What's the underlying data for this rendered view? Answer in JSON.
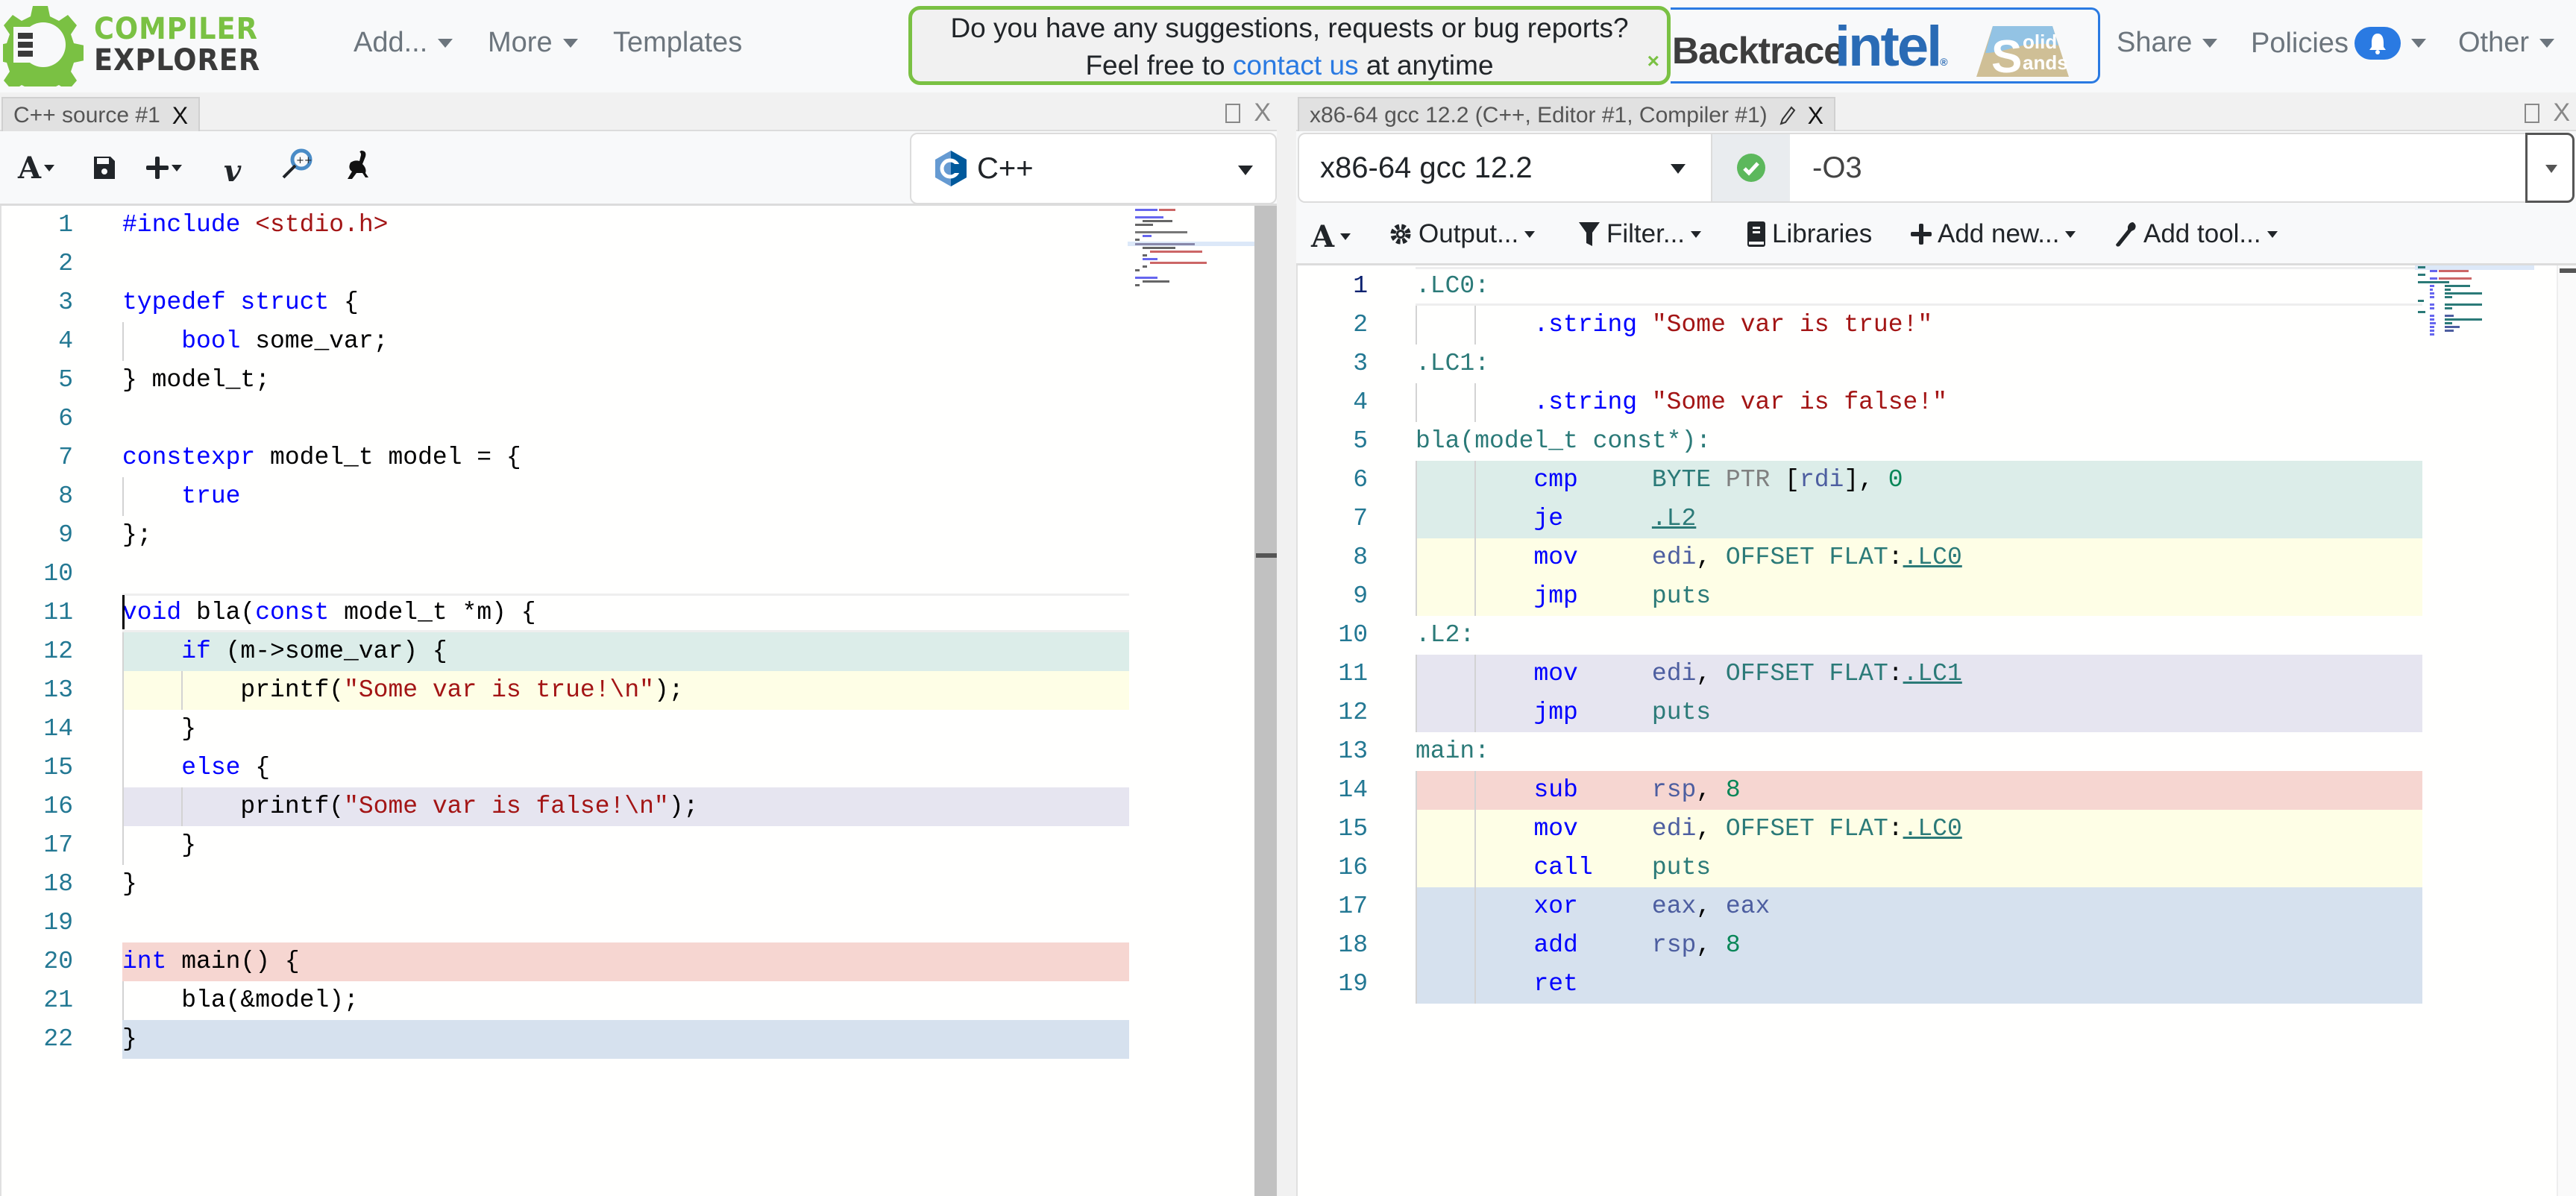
{
  "navbar": {
    "logo_line1": "COMPILER",
    "logo_line2": "EXPLORER",
    "menu": [
      {
        "label": "Add...",
        "has_caret": true
      },
      {
        "label": "More",
        "has_caret": true
      },
      {
        "label": "Templates",
        "has_caret": false
      }
    ],
    "motd": {
      "line1": "Do you have any suggestions, requests or bug reports?",
      "line2_prefix": "Feel free to ",
      "link": "contact us",
      "line2_suffix": " at anytime",
      "close": "×"
    },
    "sponsors": {
      "backtrace": "Backtrace",
      "intel": "intel",
      "intel_mark": "®",
      "solid_s": "S",
      "solid_top": "olid",
      "solid_bottom": "ands"
    },
    "right_menu": [
      {
        "label": "Share"
      },
      {
        "label": "Policies"
      },
      {
        "label": "Other"
      }
    ]
  },
  "source_pane": {
    "tab_title": "C++ source #1",
    "tab_close": "X",
    "pane_close": "X",
    "language": "C++",
    "toolbar_icons": [
      "font-size-icon",
      "save-icon",
      "add-icon",
      "vim-icon",
      "cppinsights-icon",
      "quick-bench-icon"
    ],
    "lines": [
      {
        "n": "1",
        "tokens": [
          [
            "kw",
            "#include "
          ],
          [
            "str",
            "<stdio.h>"
          ]
        ]
      },
      {
        "n": "2",
        "tokens": []
      },
      {
        "n": "3",
        "tokens": [
          [
            "kw",
            "typedef struct"
          ],
          [
            "p",
            " {"
          ]
        ]
      },
      {
        "n": "4",
        "tokens": [
          [
            "p",
            "    "
          ],
          [
            "kw",
            "bool"
          ],
          [
            "p",
            " some_var;"
          ]
        ]
      },
      {
        "n": "5",
        "tokens": [
          [
            "p",
            "} model_t;"
          ]
        ]
      },
      {
        "n": "6",
        "tokens": []
      },
      {
        "n": "7",
        "tokens": [
          [
            "kw",
            "constexpr"
          ],
          [
            "p",
            " model_t model = {"
          ]
        ]
      },
      {
        "n": "8",
        "tokens": [
          [
            "p",
            "    "
          ],
          [
            "kw",
            "true"
          ]
        ]
      },
      {
        "n": "9",
        "tokens": [
          [
            "p",
            "};"
          ]
        ]
      },
      {
        "n": "10",
        "tokens": []
      },
      {
        "n": "11",
        "tokens": [
          [
            "kw",
            "void"
          ],
          [
            "p",
            " bla("
          ],
          [
            "kw",
            "const"
          ],
          [
            "p",
            " model_t *m) {"
          ]
        ]
      },
      {
        "n": "12",
        "tokens": [
          [
            "p",
            "    "
          ],
          [
            "kw",
            "if"
          ],
          [
            "p",
            " (m->some_var) {"
          ]
        ]
      },
      {
        "n": "13",
        "tokens": [
          [
            "p",
            "        printf("
          ],
          [
            "str",
            "\"Some var is true!\\n\""
          ],
          [
            "p",
            ");"
          ]
        ]
      },
      {
        "n": "14",
        "tokens": [
          [
            "p",
            "    }"
          ]
        ]
      },
      {
        "n": "15",
        "tokens": [
          [
            "p",
            "    "
          ],
          [
            "kw",
            "else"
          ],
          [
            "p",
            " {"
          ]
        ]
      },
      {
        "n": "16",
        "tokens": [
          [
            "p",
            "        printf("
          ],
          [
            "str",
            "\"Some var is false!\\n\""
          ],
          [
            "p",
            ");"
          ]
        ]
      },
      {
        "n": "17",
        "tokens": [
          [
            "p",
            "    }"
          ]
        ]
      },
      {
        "n": "18",
        "tokens": [
          [
            "p",
            "}"
          ]
        ]
      },
      {
        "n": "19",
        "tokens": []
      },
      {
        "n": "20",
        "tokens": [
          [
            "kw",
            "int"
          ],
          [
            "p",
            " main() {"
          ]
        ]
      },
      {
        "n": "21",
        "tokens": [
          [
            "p",
            "    bla(&model);"
          ]
        ]
      },
      {
        "n": "22",
        "tokens": [
          [
            "p",
            "}"
          ]
        ]
      }
    ],
    "highlights": {
      "11": "current",
      "12": "#dcede9",
      "13": "#fefee6",
      "16": "#e6e5f0",
      "20": "#f6d6d1",
      "22": "#d6e1ee"
    }
  },
  "compiler_pane": {
    "tab_title": "x86-64 gcc 12.2 (C++, Editor #1, Compiler #1)",
    "tab_close": "X",
    "pane_close": "X",
    "compiler": "x86-64 gcc 12.2",
    "status": "success",
    "options": "-O3",
    "output_toolbar": {
      "output": "Output...",
      "filter": "Filter...",
      "libraries": "Libraries",
      "add_new": "Add new...",
      "add_tool": "Add tool..."
    },
    "lines": [
      {
        "n": "1",
        "tokens": [
          [
            "lbl",
            ".LC0:"
          ]
        ]
      },
      {
        "n": "2",
        "tokens": [
          [
            "p",
            "        "
          ],
          [
            "dir",
            ".string"
          ],
          [
            "p",
            " "
          ],
          [
            "str",
            "\"Some var is true!\""
          ]
        ]
      },
      {
        "n": "3",
        "tokens": [
          [
            "lbl",
            ".LC1:"
          ]
        ]
      },
      {
        "n": "4",
        "tokens": [
          [
            "p",
            "        "
          ],
          [
            "dir",
            ".string"
          ],
          [
            "p",
            " "
          ],
          [
            "str",
            "\"Some var is false!\""
          ]
        ]
      },
      {
        "n": "5",
        "tokens": [
          [
            "lbl",
            "bla(model_t const*):"
          ]
        ]
      },
      {
        "n": "6",
        "tokens": [
          [
            "p",
            "        "
          ],
          [
            "opc",
            "cmp"
          ],
          [
            "p",
            "     "
          ],
          [
            "lbl",
            "BYTE"
          ],
          [
            "p",
            " "
          ],
          [
            "ptr",
            "PTR"
          ],
          [
            "p",
            " ["
          ],
          [
            "reg",
            "rdi"
          ],
          [
            "p",
            "], "
          ],
          [
            "num",
            "0"
          ]
        ]
      },
      {
        "n": "7",
        "tokens": [
          [
            "p",
            "        "
          ],
          [
            "opc",
            "je"
          ],
          [
            "p",
            "      "
          ],
          [
            "link",
            ".L2"
          ]
        ]
      },
      {
        "n": "8",
        "tokens": [
          [
            "p",
            "        "
          ],
          [
            "opc",
            "mov"
          ],
          [
            "p",
            "     "
          ],
          [
            "reg",
            "edi"
          ],
          [
            "p",
            ", "
          ],
          [
            "lbl",
            "OFFSET FLAT"
          ],
          [
            "p",
            ":"
          ],
          [
            "link",
            ".LC0"
          ]
        ]
      },
      {
        "n": "9",
        "tokens": [
          [
            "p",
            "        "
          ],
          [
            "opc",
            "jmp"
          ],
          [
            "p",
            "     "
          ],
          [
            "lbl",
            "puts"
          ]
        ]
      },
      {
        "n": "10",
        "tokens": [
          [
            "lbl",
            ".L2:"
          ]
        ]
      },
      {
        "n": "11",
        "tokens": [
          [
            "p",
            "        "
          ],
          [
            "opc",
            "mov"
          ],
          [
            "p",
            "     "
          ],
          [
            "reg",
            "edi"
          ],
          [
            "p",
            ", "
          ],
          [
            "lbl",
            "OFFSET FLAT"
          ],
          [
            "p",
            ":"
          ],
          [
            "link",
            ".LC1"
          ]
        ]
      },
      {
        "n": "12",
        "tokens": [
          [
            "p",
            "        "
          ],
          [
            "opc",
            "jmp"
          ],
          [
            "p",
            "     "
          ],
          [
            "lbl",
            "puts"
          ]
        ]
      },
      {
        "n": "13",
        "tokens": [
          [
            "lbl",
            "main:"
          ]
        ]
      },
      {
        "n": "14",
        "tokens": [
          [
            "p",
            "        "
          ],
          [
            "opc",
            "sub"
          ],
          [
            "p",
            "     "
          ],
          [
            "reg",
            "rsp"
          ],
          [
            "p",
            ", "
          ],
          [
            "num",
            "8"
          ]
        ]
      },
      {
        "n": "15",
        "tokens": [
          [
            "p",
            "        "
          ],
          [
            "opc",
            "mov"
          ],
          [
            "p",
            "     "
          ],
          [
            "reg",
            "edi"
          ],
          [
            "p",
            ", "
          ],
          [
            "lbl",
            "OFFSET FLAT"
          ],
          [
            "p",
            ":"
          ],
          [
            "link",
            ".LC0"
          ]
        ]
      },
      {
        "n": "16",
        "tokens": [
          [
            "p",
            "        "
          ],
          [
            "opc",
            "call"
          ],
          [
            "p",
            "    "
          ],
          [
            "lbl",
            "puts"
          ]
        ]
      },
      {
        "n": "17",
        "tokens": [
          [
            "p",
            "        "
          ],
          [
            "opc",
            "xor"
          ],
          [
            "p",
            "     "
          ],
          [
            "reg",
            "eax"
          ],
          [
            "p",
            ", "
          ],
          [
            "reg",
            "eax"
          ]
        ]
      },
      {
        "n": "18",
        "tokens": [
          [
            "p",
            "        "
          ],
          [
            "opc",
            "add"
          ],
          [
            "p",
            "     "
          ],
          [
            "reg",
            "rsp"
          ],
          [
            "p",
            ", "
          ],
          [
            "num",
            "8"
          ]
        ]
      },
      {
        "n": "19",
        "tokens": [
          [
            "p",
            "        "
          ],
          [
            "opc",
            "ret"
          ]
        ]
      }
    ],
    "highlights": {
      "1": "current",
      "6": "#dcede9",
      "7": "#dcede9",
      "8": "#fefee6",
      "9": "#fefee6",
      "11": "#e6e5f0",
      "12": "#e6e5f0",
      "14": "#f6d6d1",
      "15": "#fefee6",
      "16": "#fefee6",
      "17": "#d6e1ee",
      "18": "#d6e1ee",
      "19": "#d6e1ee"
    }
  },
  "colors": {
    "brand_green": "#7ac143",
    "brand_dark": "#3a3a3a",
    "link_blue": "#2a7ae2",
    "line_number": "#237893",
    "keyword": "#0000ff",
    "string": "#a31515",
    "asm_label": "#2b7a78",
    "asm_register": "#4d5ea0",
    "asm_number": "#098658",
    "success_green": "#5cb85c"
  }
}
